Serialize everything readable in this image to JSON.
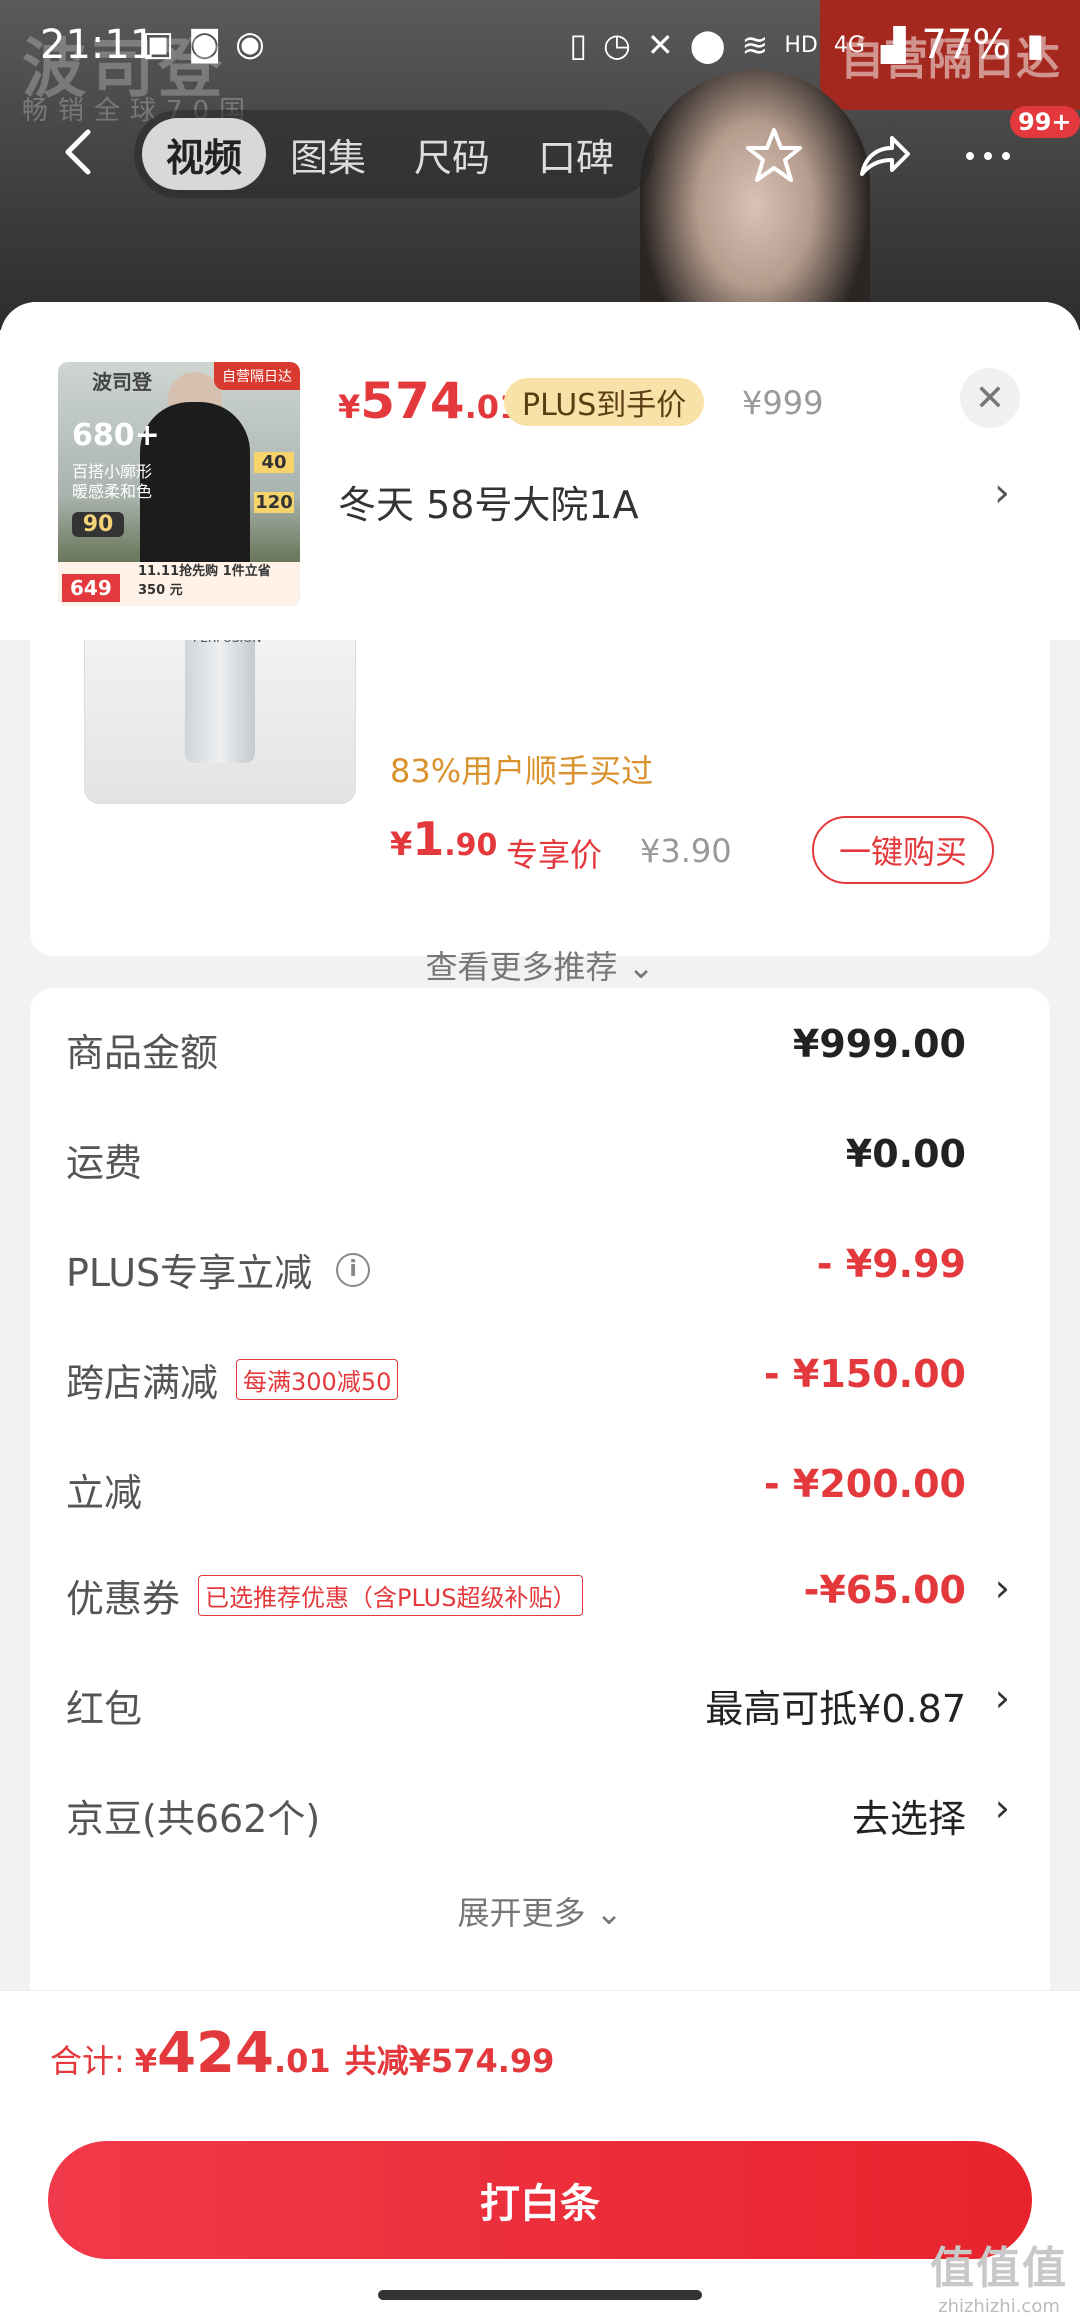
{
  "statusbar": {
    "time": "21:11",
    "hd": "HD",
    "network": "4G",
    "battery": "77%"
  },
  "background": {
    "brand": "波司登",
    "slogan": "畅销全球70国",
    "badge": "自营隔日达"
  },
  "nav": {
    "tabs": [
      "视频",
      "图集",
      "尺码",
      "口碑"
    ],
    "badge": "99+"
  },
  "product": {
    "price_currency": "¥",
    "price_int": "574",
    "price_dec": ".01",
    "plus_label": "PLUS到手价",
    "original_price": "¥999",
    "spec": "冬天  58号大院1A",
    "thumb": {
      "brand": "波司登",
      "tag": "自营隔日达",
      "big": "680+",
      "line1": "百搭小廓形",
      "line2": "暖感柔和色",
      "fill": "90",
      "p1": "40",
      "p2": "120",
      "price": "649",
      "bottom_text": "11.11抢先购 1件立省 350 元"
    }
  },
  "recommend": {
    "bought": "83%用户顺手买过",
    "price_currency": "¥",
    "price_int": "1",
    "price_dec": ".90",
    "exclusive_label": "专享价",
    "original_price": "¥3.90",
    "buy_label": "一键购买",
    "see_more": "查看更多推荐 ⌄",
    "bottle_text": "PERFUSION"
  },
  "amounts": [
    {
      "label": "商品金额",
      "value": "¥999.00"
    },
    {
      "label": "运费",
      "value": "¥0.00"
    },
    {
      "label": "PLUS专享立减",
      "value": "- ¥9.99"
    },
    {
      "label": "跨店满减",
      "tag": "每满300减50",
      "value": "- ¥150.00"
    },
    {
      "label": "立减",
      "value": "- ¥200.00"
    },
    {
      "label": "优惠券",
      "tag": "已选推荐优惠（含PLUS超级补贴）",
      "value": "-¥65.00"
    },
    {
      "label": "红包",
      "value": "最高可抵¥0.87"
    },
    {
      "label": "京豆(共662个)",
      "value": "去选择"
    }
  ],
  "expand_more": "展开更多 ⌄",
  "footer": {
    "total_label": "合计:",
    "currency": "¥",
    "total_int": "424",
    "total_dec": ".01",
    "saved": "共减¥574.99",
    "pay_button": "打白条"
  },
  "watermark": {
    "big": "值值值",
    "small": "zhizhizhi.com"
  },
  "colors": {
    "accent": "#e4393c",
    "plus_tag_bg": "#f9e2a7",
    "gold_text": "#d9922e"
  },
  "icons": [
    "back-arrow-icon",
    "star-icon",
    "share-icon",
    "more-icon",
    "close-icon",
    "chevron-right-icon",
    "info-icon"
  ]
}
